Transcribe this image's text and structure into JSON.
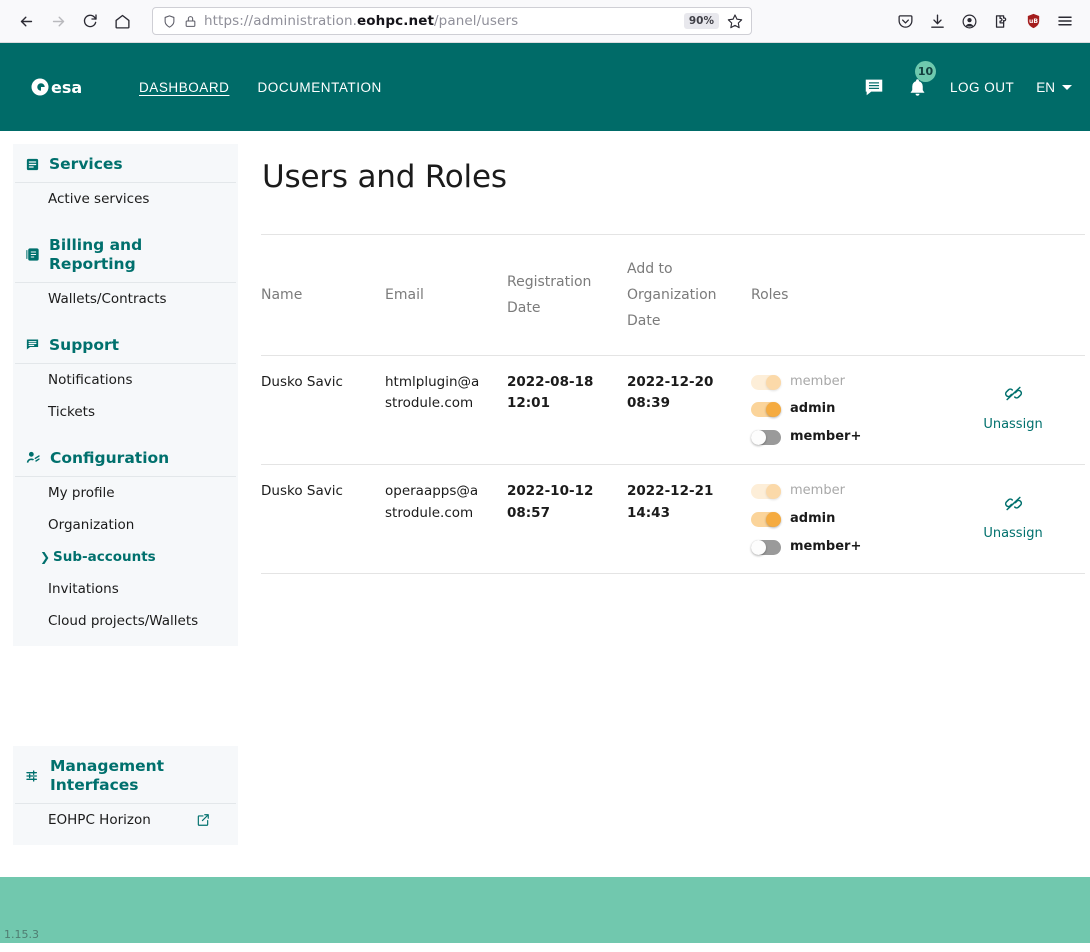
{
  "browser": {
    "back_icon": "back-arrow-icon",
    "forward_icon": "forward-arrow-icon",
    "reload_icon": "reload-icon",
    "home_icon": "home-icon",
    "shield_icon": "tracking-shield-icon",
    "lock_icon": "padlock-icon",
    "url_prefix": "https://administration.",
    "url_domain": "eohpc.net",
    "url_suffix": "/panel/users",
    "url_full": "https://administration.eohpc.net/panel/users",
    "zoom_level": "90%",
    "bookmark_icon": "star-icon",
    "pocket_icon": "pocket-icon",
    "downloads_icon": "download-icon",
    "account_icon": "account-circle-icon",
    "extensions_icon": "extension-puzzle-icon",
    "ublock_icon": "ublock-shield-icon",
    "ublock_label": "uB",
    "menu_icon": "hamburger-menu-icon"
  },
  "header": {
    "logo": "esa-logo",
    "logo_text": "esa",
    "nav": [
      {
        "label": "DASHBOARD",
        "active": true
      },
      {
        "label": "DOCUMENTATION",
        "active": false
      }
    ],
    "chat_icon": "chat-bubble-icon",
    "bell_icon": "notification-bell-icon",
    "notification_count": "10",
    "logout_label": "LOG OUT",
    "language": "EN",
    "brand_color": "#006b68",
    "badge_color": "#6ec9ae"
  },
  "sidebar": {
    "sections": [
      {
        "title": "Services",
        "icon": "services-list-icon",
        "items": [
          {
            "label": "Active services",
            "active": false,
            "external": false
          }
        ]
      },
      {
        "title": "Billing and Reporting",
        "icon": "billing-book-icon",
        "items": [
          {
            "label": "Wallets/Contracts",
            "active": false,
            "external": false
          }
        ]
      },
      {
        "title": "Support",
        "icon": "support-chat-icon",
        "items": [
          {
            "label": "Notifications",
            "active": false,
            "external": false
          },
          {
            "label": "Tickets",
            "active": false,
            "external": false
          }
        ]
      },
      {
        "title": "Configuration",
        "icon": "configuration-user-icon",
        "items": [
          {
            "label": "My profile",
            "active": false,
            "external": false
          },
          {
            "label": "Organization",
            "active": false,
            "external": false
          },
          {
            "label": "Sub-accounts",
            "active": true,
            "external": false
          },
          {
            "label": "Invitations",
            "active": false,
            "external": false
          },
          {
            "label": "Cloud projects/Wallets",
            "active": false,
            "external": false
          }
        ]
      },
      {
        "title": "Management Interfaces",
        "icon": "sliders-settings-icon",
        "items": [
          {
            "label": "EOHPC Horizon",
            "active": false,
            "external": true
          }
        ]
      }
    ]
  },
  "main": {
    "page_title": "Users and Roles",
    "table": {
      "columns": [
        "Name",
        "Email",
        "Registration Date",
        "Add to Organization Date",
        "Roles",
        ""
      ],
      "rows": [
        {
          "name": "Dusko Savic",
          "email": "htmlplugin@astrodule.com",
          "registration_date": "2022-08-18 12:01",
          "add_to_org_date": "2022-12-20 08:39",
          "roles": [
            {
              "label": "member",
              "on": true,
              "disabled": true
            },
            {
              "label": "admin",
              "on": true,
              "disabled": false
            },
            {
              "label": "member+",
              "on": false,
              "disabled": false
            }
          ],
          "action_label": "Unassign",
          "action_icon": "broken-link-icon"
        },
        {
          "name": "Dusko Savic",
          "email": "operaapps@astrodule.com",
          "registration_date": "2022-10-12 08:57",
          "add_to_org_date": "2022-12-21 14:43",
          "roles": [
            {
              "label": "member",
              "on": true,
              "disabled": true
            },
            {
              "label": "admin",
              "on": true,
              "disabled": false
            },
            {
              "label": "member+",
              "on": false,
              "disabled": false
            }
          ],
          "action_label": "Unassign",
          "action_icon": "broken-link-icon"
        }
      ]
    }
  },
  "footer": {
    "version": "1.15.3",
    "background": "#71c8ae"
  }
}
